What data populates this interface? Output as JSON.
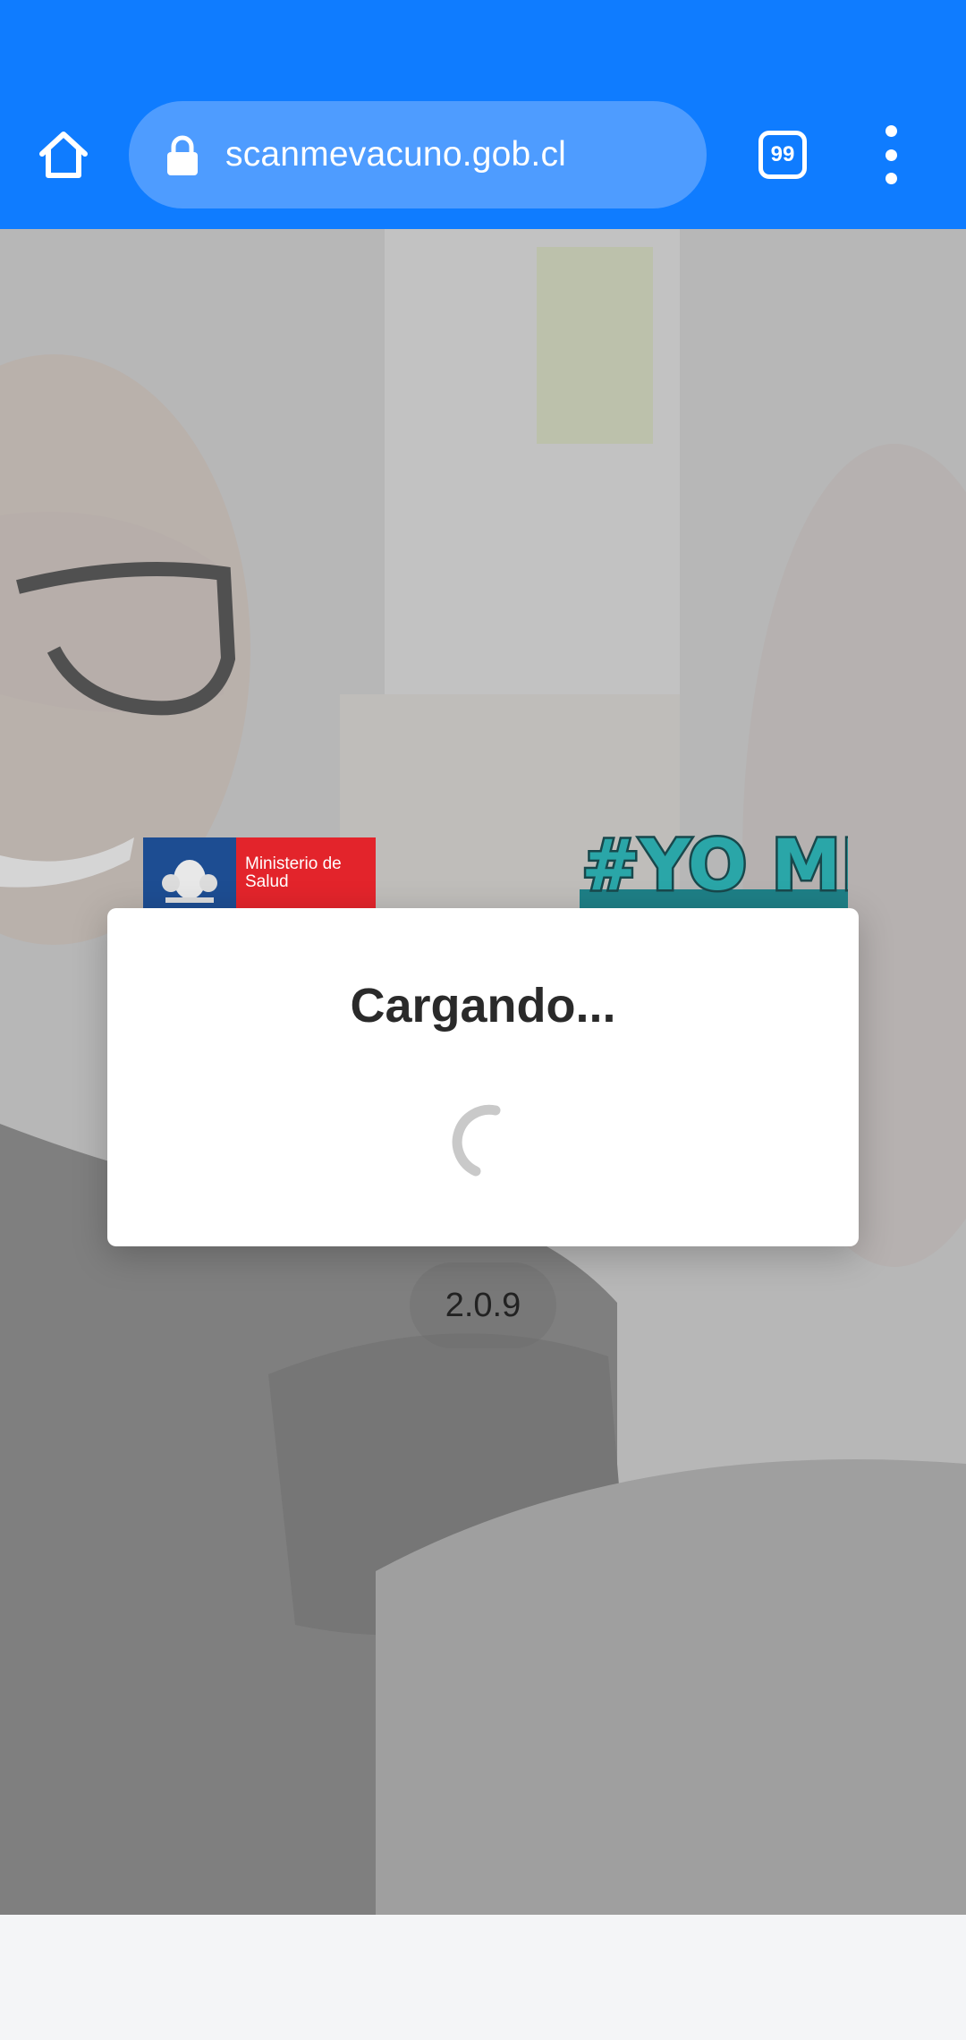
{
  "browser": {
    "url": "scanmevacuno.gob.cl",
    "tab_count": "99",
    "accent_color": "#0f7cff",
    "icons": [
      "home-icon",
      "lock-icon",
      "tabs-icon",
      "more-vert-icon"
    ]
  },
  "page": {
    "ministry_logo_text": "Ministerio de Salud",
    "campaign_text": "#YO ME",
    "version": "2.0.9"
  },
  "dialog": {
    "title": "Cargando...",
    "spinner_icon": "loading-spinner-icon"
  }
}
